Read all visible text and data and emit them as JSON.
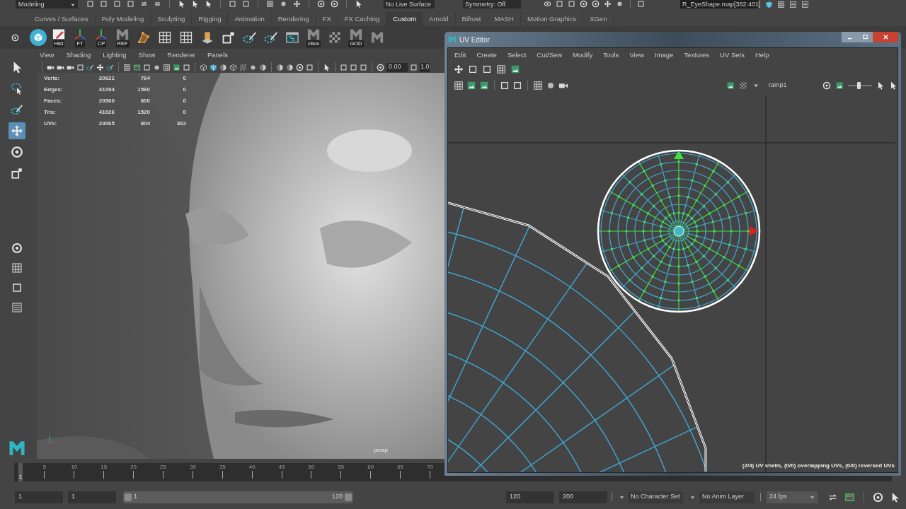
{
  "status_line": {
    "mode": "Modeling",
    "live_surface": "No Live Surface",
    "symmetry": "Symmetry: Off",
    "selection_field": "R_EyeShape.map[382:401]"
  },
  "shelf": {
    "tabs": [
      {
        "label": "Curves / Surfaces",
        "selected": false
      },
      {
        "label": "Poly Modeling",
        "selected": false
      },
      {
        "label": "Sculpting",
        "selected": false
      },
      {
        "label": "Rigging",
        "selected": false
      },
      {
        "label": "Animation",
        "selected": false
      },
      {
        "label": "Rendering",
        "selected": false
      },
      {
        "label": "FX",
        "selected": false
      },
      {
        "label": "FX Caching",
        "selected": false
      },
      {
        "label": "Custom",
        "selected": true
      },
      {
        "label": "Arnold",
        "selected": false
      },
      {
        "label": "Bifrost",
        "selected": false
      },
      {
        "label": "MASH",
        "selected": false
      },
      {
        "label": "Motion Graphics",
        "selected": false
      },
      {
        "label": "XGen",
        "selected": false
      }
    ],
    "items": [
      {
        "kind": "cube"
      },
      {
        "kind": "labeled",
        "label": "Hist"
      },
      {
        "kind": "labeled",
        "label": "FT"
      },
      {
        "kind": "labeled",
        "label": "CP"
      },
      {
        "kind": "labeled",
        "label": "REF"
      },
      {
        "kind": "tool"
      },
      {
        "kind": "tool"
      },
      {
        "kind": "tool"
      },
      {
        "kind": "tool"
      },
      {
        "kind": "tool"
      },
      {
        "kind": "tool"
      },
      {
        "kind": "tool"
      },
      {
        "kind": "tool"
      },
      {
        "kind": "labeled",
        "label": "cBox"
      },
      {
        "kind": "tool"
      },
      {
        "kind": "labeled",
        "label": "GOD"
      },
      {
        "kind": "tool"
      }
    ]
  },
  "tools": [
    {
      "kind": "arrow",
      "selected": false
    },
    {
      "kind": "lasso",
      "selected": false
    },
    {
      "kind": "brush",
      "selected": false
    },
    {
      "kind": "move",
      "selected": true
    },
    {
      "kind": "rotate",
      "selected": false
    },
    {
      "kind": "scale",
      "selected": false
    }
  ],
  "viewport": {
    "menu": [
      "View",
      "Shading",
      "Lighting",
      "Show",
      "Renderer",
      "Panels"
    ],
    "exposure": "0.00",
    "gamma": "1.0",
    "hud": [
      {
        "label": "Verts:",
        "values": [
          "20621",
          "764",
          "0"
        ]
      },
      {
        "label": "Edges:",
        "values": [
          "41094",
          "1560",
          "0"
        ]
      },
      {
        "label": "Faces:",
        "values": [
          "20560",
          "800",
          "0"
        ]
      },
      {
        "label": "Tris:",
        "values": [
          "41026",
          "1520",
          "0"
        ]
      },
      {
        "label": "UVs:",
        "values": [
          "23065",
          "804",
          "362"
        ]
      }
    ],
    "camera": "persp"
  },
  "uv_editor": {
    "title": "UV Editor",
    "menu": [
      "Edit",
      "Create",
      "Select",
      "Cut/Sew",
      "Modify",
      "Tools",
      "View",
      "Image",
      "Textures",
      "UV Sets",
      "Help"
    ],
    "texture": "ramp1",
    "exposure_slider": {
      "level": 0.45
    },
    "status": "(2/4) UV shells, (0/0) overlapping UVs, (0/0) reversed UVs"
  },
  "timeline": {
    "current": "1",
    "ticks": [
      "5",
      "10",
      "15",
      "20",
      "25",
      "30",
      "35",
      "40",
      "45",
      "50",
      "55",
      "60",
      "65",
      "70"
    ]
  },
  "range": {
    "start": "1",
    "playback_start": "1",
    "bar": {
      "level": 1
    },
    "slider_start": "1",
    "slider_end": "120",
    "playback_end": "120",
    "end": "200",
    "character_set": "No Character Set",
    "anim_layer": "No Anim Layer",
    "fps": "24 fps"
  }
}
